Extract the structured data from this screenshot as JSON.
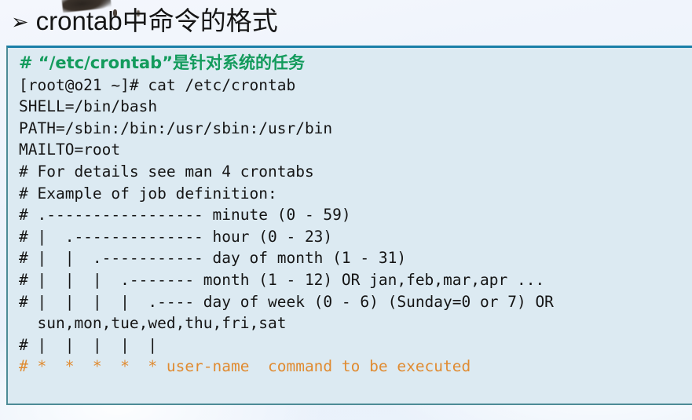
{
  "slide": {
    "title": {
      "bullet": "➢",
      "text": "crontab中命令的格式"
    },
    "colors": {
      "page_background": "#eef3fb",
      "code_background": "#dceaf2",
      "code_border": "#4d8b96",
      "code_border_top": "#1a7fa8",
      "comment_green": "#139b5c",
      "highlight_orange": "#e08b31",
      "body_text": "#151515"
    },
    "code": {
      "lines": [
        {
          "id": "line-comment-etc-crontab",
          "style": "green",
          "text": "# “/etc/crontab”是针对系统的任务"
        },
        {
          "id": "line-prompt-cat",
          "style": "dark",
          "text": "[root@o21 ~]# cat /etc/crontab"
        },
        {
          "id": "line-shell",
          "style": "dark",
          "text": "SHELL=/bin/bash"
        },
        {
          "id": "line-path",
          "style": "dark",
          "text": "PATH=/sbin:/bin:/usr/sbin:/usr/bin"
        },
        {
          "id": "line-mailto",
          "style": "dark",
          "text": "MAILTO=root"
        },
        {
          "id": "line-for-details",
          "style": "dark",
          "text": "# For details see man 4 crontabs"
        },
        {
          "id": "line-example-of-job",
          "style": "dark",
          "text": "# Example of job definition:"
        },
        {
          "id": "line-minute",
          "style": "dark",
          "text": "# .----------------- minute (0 - 59)"
        },
        {
          "id": "line-hour",
          "style": "dark",
          "text": "# |  .-------------- hour (0 - 23)"
        },
        {
          "id": "line-day-of-month",
          "style": "dark",
          "text": "# |  |  .----------- day of month (1 - 31)"
        },
        {
          "id": "line-month",
          "style": "dark",
          "text": "# |  |  |  .------- month (1 - 12) OR jan,feb,mar,apr ..."
        },
        {
          "id": "line-day-of-week",
          "style": "dark",
          "text": "# |  |  |  |  .---- day of week (0 - 6) (Sunday=0 or 7) OR"
        },
        {
          "id": "line-day-names",
          "style": "dark",
          "text": "  sun,mon,tue,wed,thu,fri,sat"
        },
        {
          "id": "line-pipes",
          "style": "dark",
          "text": "# |  |  |  |  |"
        },
        {
          "id": "line-stars-usage",
          "style": "orange",
          "text": "# *  *  *  *  * user-name  command to be executed"
        }
      ]
    }
  }
}
